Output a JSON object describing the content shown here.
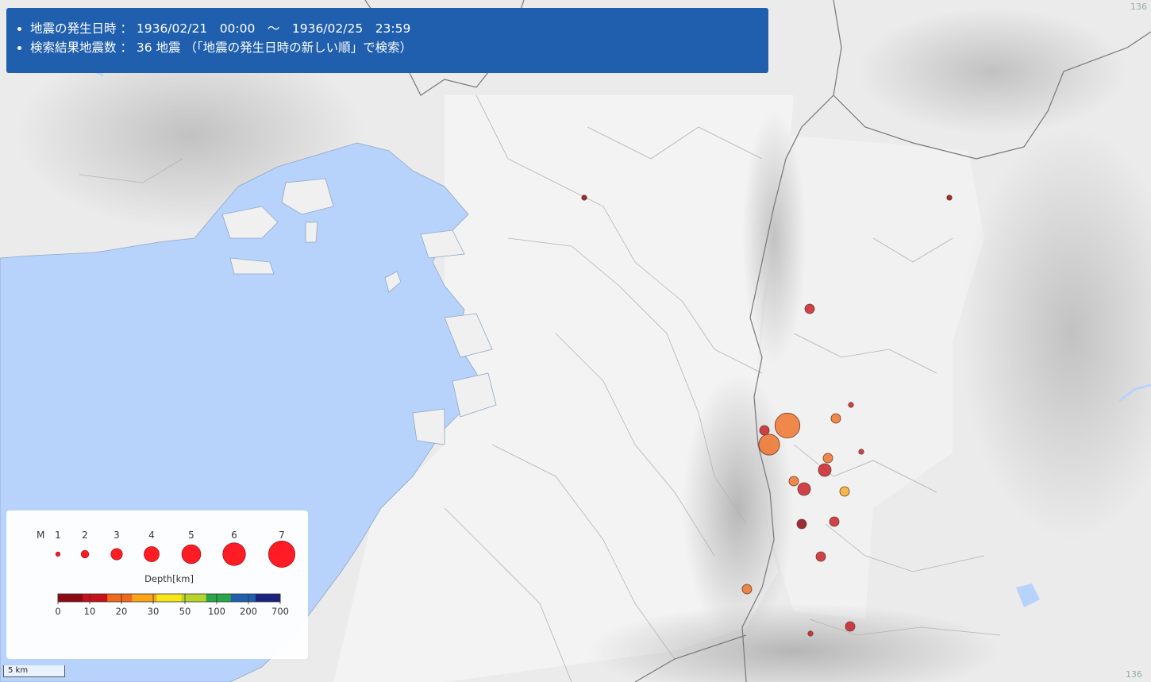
{
  "header": {
    "date_range_line": "地震の発生日時 ： 1936/02/21　00:00　～　1936/02/25　23:59",
    "result_count_line": "検索結果地震数 ： 36 地震 （「地震の発生日時の新しい順」で検索）"
  },
  "legend": {
    "magnitude_label": "M",
    "magnitudes": [
      "1",
      "2",
      "3",
      "4",
      "5",
      "6",
      "7"
    ],
    "depth_title": "Depth[km]",
    "depth_ticks": [
      "0",
      "10",
      "20",
      "30",
      "50",
      "100",
      "200",
      "700"
    ],
    "depth_colors": [
      "#8c0a16",
      "#c8101b",
      "#f06a1c",
      "#f9a51a",
      "#f8e61b",
      "#b8d42a",
      "#2aa54a",
      "#1f5fae",
      "#1a237e"
    ]
  },
  "scale_bar": {
    "label": "5 km"
  },
  "corner_labels": {
    "top_right": "136",
    "bottom_right": "136"
  },
  "colors": {
    "water": "#b8d3fb",
    "land": "#f0f0f0",
    "header_bg": "#1f5fae",
    "quake": "#ff1c24"
  },
  "earthquakes": [
    {
      "magnitude": 1,
      "depth_band": 0,
      "id": "q1"
    },
    {
      "magnitude": 1,
      "depth_band": 0,
      "id": "q2"
    },
    {
      "magnitude": 3,
      "depth_band": 1,
      "id": "q3"
    },
    {
      "magnitude": 6,
      "depth_band": 2,
      "id": "q4"
    },
    {
      "magnitude": 3,
      "depth_band": 2,
      "id": "q5"
    },
    {
      "magnitude": 1,
      "depth_band": 1,
      "id": "q6"
    },
    {
      "magnitude": 3,
      "depth_band": 1,
      "id": "q7"
    },
    {
      "magnitude": 5,
      "depth_band": 2,
      "id": "q8"
    },
    {
      "magnitude": 1,
      "depth_band": 1,
      "id": "q9"
    },
    {
      "magnitude": 3,
      "depth_band": 2,
      "id": "q10"
    },
    {
      "magnitude": 4,
      "depth_band": 1,
      "id": "q11"
    },
    {
      "magnitude": 3,
      "depth_band": 2,
      "id": "q12"
    },
    {
      "magnitude": 4,
      "depth_band": 1,
      "id": "q13"
    },
    {
      "magnitude": 3,
      "depth_band": 3,
      "id": "q14"
    },
    {
      "magnitude": 3,
      "depth_band": 0,
      "id": "q15"
    },
    {
      "magnitude": 3,
      "depth_band": 1,
      "id": "q16"
    },
    {
      "magnitude": 3,
      "depth_band": 1,
      "id": "q17"
    },
    {
      "magnitude": 3,
      "depth_band": 2,
      "id": "q18"
    },
    {
      "magnitude": 1,
      "depth_band": 1,
      "id": "q19"
    },
    {
      "magnitude": 3,
      "depth_band": 1,
      "id": "q20"
    }
  ]
}
